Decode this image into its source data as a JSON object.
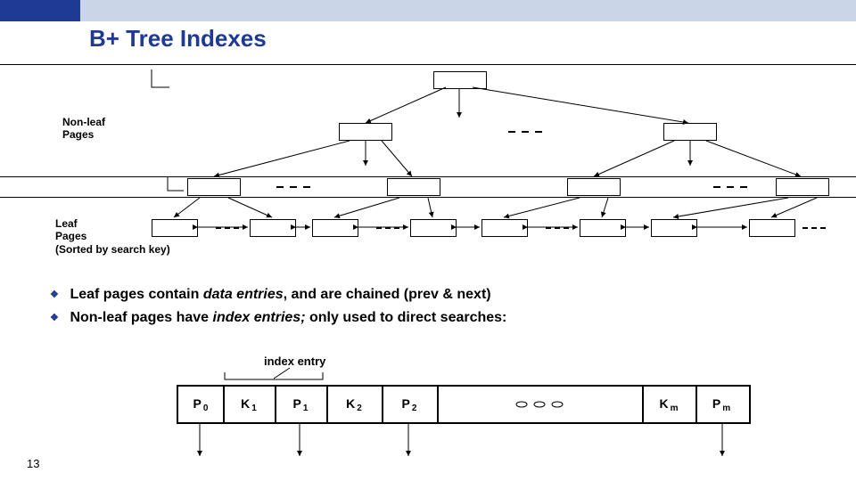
{
  "title": "B+ Tree Indexes",
  "labels": {
    "nonleaf": "Non-leaf\nPages",
    "leaf": "Leaf\nPages\n(Sorted by search key)"
  },
  "bullets": [
    {
      "pre": "Leaf pages contain ",
      "em": "data entries",
      "post": ", and are chained (prev & next)"
    },
    {
      "pre": "Non-leaf pages have ",
      "em": "index entries;",
      "post": " only used to direct searches:"
    }
  ],
  "entry": {
    "label": "index entry",
    "cells": [
      {
        "main": "P",
        "sub": "0"
      },
      {
        "main": "K",
        "sub": "1"
      },
      {
        "main": "P",
        "sub": "1"
      },
      {
        "main": "K",
        "sub": "2"
      },
      {
        "main": "P",
        "sub": "2"
      },
      {
        "main": "",
        "sub": "",
        "dots": true
      },
      {
        "main": "K",
        "sub": "m"
      },
      {
        "main": "P",
        "sub": "m"
      }
    ]
  },
  "page_number": "13"
}
